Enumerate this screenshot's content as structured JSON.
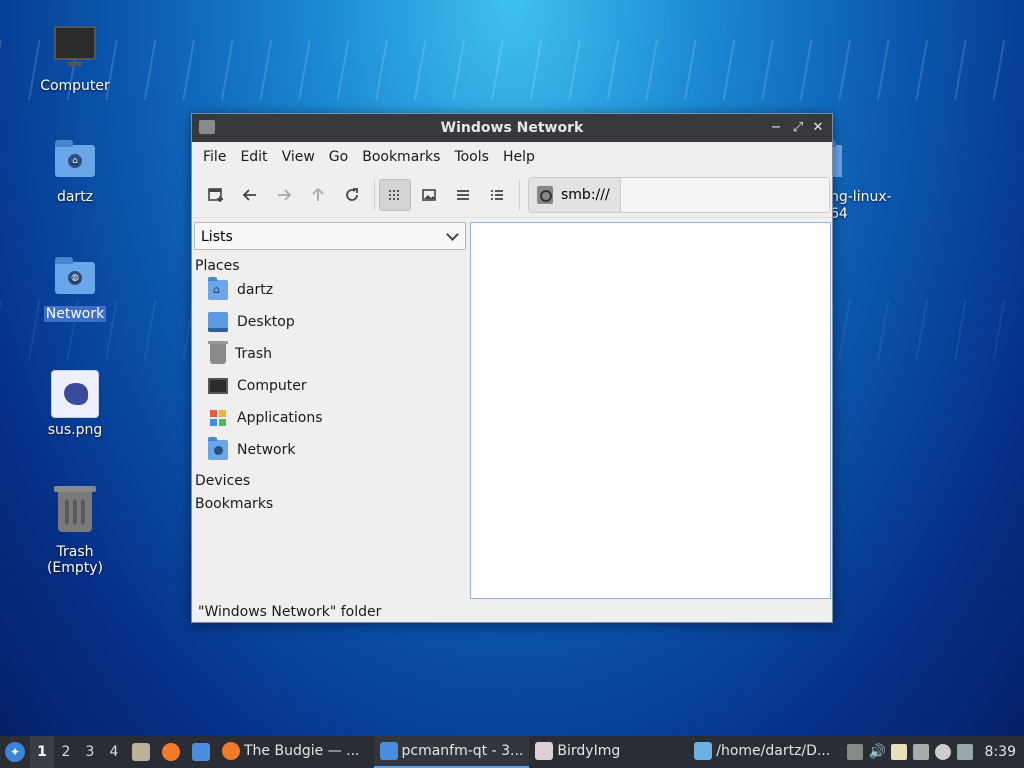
{
  "desktop": {
    "icons": [
      {
        "label": "Computer"
      },
      {
        "label": "dartz"
      },
      {
        "label": "Network"
      },
      {
        "label": "sus.png"
      },
      {
        "label": "Trash (Empty)"
      },
      {
        "label": "ng-linux-\n64"
      }
    ]
  },
  "window": {
    "title": "Windows Network",
    "controls": {
      "minimize": "−",
      "maximize": "⤢",
      "close": "✕"
    }
  },
  "menu": [
    "File",
    "Edit",
    "View",
    "Go",
    "Bookmarks",
    "Tools",
    "Help"
  ],
  "toolbar": {
    "icons": [
      "new-tab-icon",
      "back-arrow-icon",
      "forward-arrow-icon",
      "up-arrow-icon",
      "reload-icon",
      "icon-view-icon",
      "thumbnail-view-icon",
      "compact-view-icon",
      "detailed-list-icon"
    ]
  },
  "pathbar": {
    "path": "smb:///"
  },
  "sidebar": {
    "mode": "Lists",
    "places_header": "Places",
    "places": [
      {
        "label": "dartz"
      },
      {
        "label": "Desktop"
      },
      {
        "label": "Trash"
      },
      {
        "label": "Computer"
      },
      {
        "label": "Applications"
      },
      {
        "label": "Network"
      }
    ],
    "devices_header": "Devices",
    "bookmarks_header": "Bookmarks"
  },
  "status": "\"Windows Network\" folder",
  "taskbar": {
    "workspaces": [
      "1",
      "2",
      "3",
      "4"
    ],
    "tasks": [
      {
        "label": "The Budgie — ..."
      },
      {
        "label": "pcmanfm-qt - 3..."
      },
      {
        "label": "BirdyImg"
      },
      {
        "label": "/home/dartz/D..."
      }
    ],
    "clock": "8:39"
  },
  "colors": {
    "accent": "#5ea0e8",
    "titlebar": "#37393d",
    "taskbar": "#2a2d33"
  }
}
